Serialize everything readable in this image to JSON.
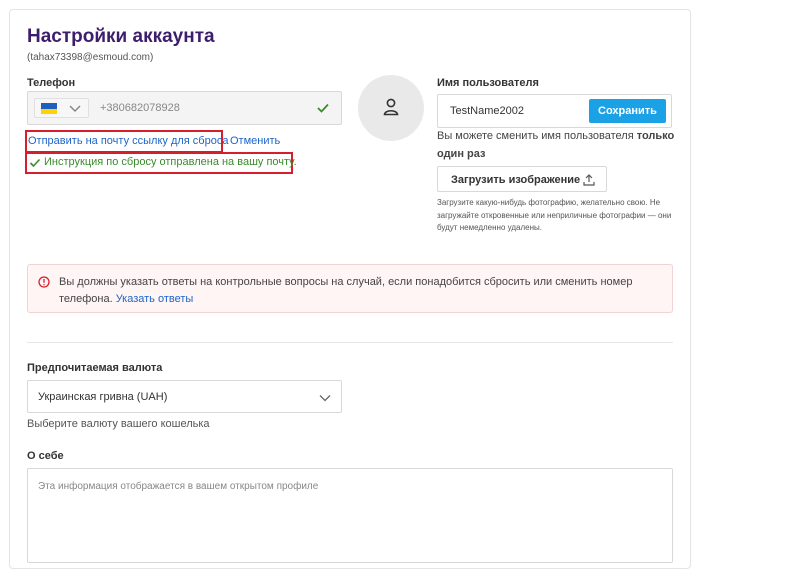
{
  "page": {
    "title": "Настройки аккаунта",
    "email": "(tahax73398@esmoud.com)"
  },
  "phone": {
    "label": "Телефон",
    "country": "Ukraine",
    "value": "+380682078928",
    "verified_icon": "check-icon"
  },
  "reset": {
    "send_link": "Отправить на почту ссылку для сброса",
    "cancel": "Отменить",
    "success": "Инструкция по сбросу отправлена на вашу почту."
  },
  "avatar": {
    "icon": "user-icon"
  },
  "username": {
    "label": "Имя пользователя",
    "value": "TestName2002",
    "save": "Сохранить",
    "hint_prefix": "Вы можете сменить имя пользователя ",
    "hint_bold_1": "только",
    "hint_bold_2": "один раз"
  },
  "upload": {
    "label": "Загрузить изображение",
    "icon": "upload-icon",
    "note": "Загрузите какую-нибудь фотографию, желательно свою. Не загружайте откровенные или неприличные фотографии — они будут немедленно удалены."
  },
  "alert": {
    "icon": "info-circle-icon",
    "text": "Вы должны указать ответы на контрольные вопросы на случай, если понадобится сбросить или сменить номер телефона.",
    "link": "Указать ответы",
    "color": "#d61f2c"
  },
  "currency": {
    "label": "Предпочитаемая валюта",
    "selected": "Украинская гривна (UAH)",
    "description": "Выберите валюту вашего кошелька"
  },
  "about": {
    "label": "О себе",
    "placeholder": "Эта информация отображается в вашем открытом профиле"
  },
  "colors": {
    "title": "#3d1e6d",
    "accent_button": "#1aa1e6",
    "link": "#1d64c9",
    "success": "#3b8a2d",
    "highlight_box": "#d61f2c"
  }
}
